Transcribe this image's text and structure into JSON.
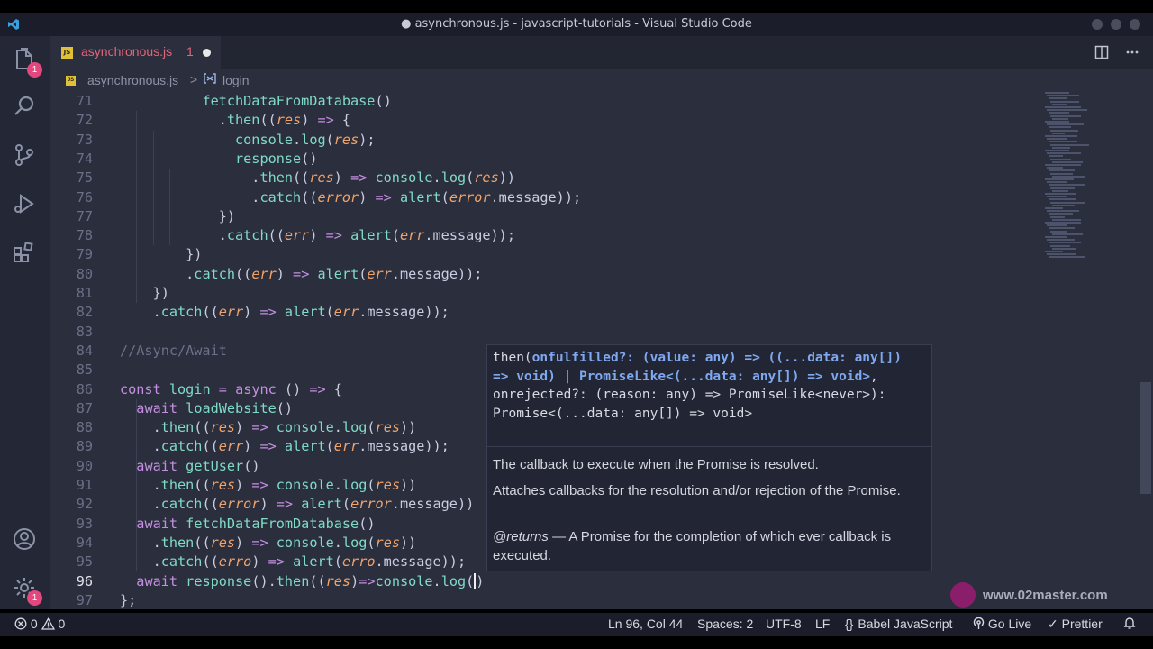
{
  "window": {
    "title": "● asynchronous.js - javascript-tutorials - Visual Studio Code"
  },
  "activity_bar": {
    "explorer_badge": "1",
    "settings_badge": "1"
  },
  "tab": {
    "file_icon": "JS",
    "name": "asynchronous.js",
    "problems": "1"
  },
  "breadcrumb": {
    "file": "asynchronous.js",
    "separator": ">",
    "symbol": "login"
  },
  "code_lines": [
    {
      "n": "71",
      "tokens": [
        [
          "pl",
          "          "
        ],
        [
          "fn",
          "fetchDataFromDatabase"
        ],
        [
          "pl",
          "()"
        ]
      ]
    },
    {
      "n": "72",
      "tokens": [
        [
          "pl",
          "            ."
        ],
        [
          "m",
          "then"
        ],
        [
          "pl",
          "(("
        ],
        [
          "par",
          "res"
        ],
        [
          "pl",
          ") "
        ],
        [
          "op",
          "=>"
        ],
        [
          "pl",
          " {"
        ]
      ]
    },
    {
      "n": "73",
      "tokens": [
        [
          "pl",
          "              "
        ],
        [
          "m",
          "console"
        ],
        [
          "pl",
          "."
        ],
        [
          "m",
          "log"
        ],
        [
          "pl",
          "("
        ],
        [
          "par",
          "res"
        ],
        [
          "pl",
          ");"
        ]
      ]
    },
    {
      "n": "74",
      "tokens": [
        [
          "pl",
          "              "
        ],
        [
          "fn",
          "response"
        ],
        [
          "pl",
          "()"
        ]
      ]
    },
    {
      "n": "75",
      "tokens": [
        [
          "pl",
          "                ."
        ],
        [
          "m",
          "then"
        ],
        [
          "pl",
          "(("
        ],
        [
          "par",
          "res"
        ],
        [
          "pl",
          ") "
        ],
        [
          "op",
          "=>"
        ],
        [
          "pl",
          " "
        ],
        [
          "m",
          "console"
        ],
        [
          "pl",
          "."
        ],
        [
          "m",
          "log"
        ],
        [
          "pl",
          "("
        ],
        [
          "par",
          "res"
        ],
        [
          "pl",
          "))"
        ]
      ]
    },
    {
      "n": "76",
      "tokens": [
        [
          "pl",
          "                ."
        ],
        [
          "m",
          "catch"
        ],
        [
          "pl",
          "(("
        ],
        [
          "par",
          "error"
        ],
        [
          "pl",
          ") "
        ],
        [
          "op",
          "=>"
        ],
        [
          "pl",
          " "
        ],
        [
          "m",
          "alert"
        ],
        [
          "pl",
          "("
        ],
        [
          "par",
          "error"
        ],
        [
          "pl",
          ".message));"
        ]
      ]
    },
    {
      "n": "77",
      "tokens": [
        [
          "pl",
          "            })"
        ]
      ]
    },
    {
      "n": "78",
      "tokens": [
        [
          "pl",
          "            ."
        ],
        [
          "m",
          "catch"
        ],
        [
          "pl",
          "(("
        ],
        [
          "par",
          "err"
        ],
        [
          "pl",
          ") "
        ],
        [
          "op",
          "=>"
        ],
        [
          "pl",
          " "
        ],
        [
          "m",
          "alert"
        ],
        [
          "pl",
          "("
        ],
        [
          "par",
          "err"
        ],
        [
          "pl",
          ".message));"
        ]
      ]
    },
    {
      "n": "79",
      "tokens": [
        [
          "pl",
          "        })"
        ]
      ]
    },
    {
      "n": "80",
      "tokens": [
        [
          "pl",
          "        ."
        ],
        [
          "m",
          "catch"
        ],
        [
          "pl",
          "(("
        ],
        [
          "par",
          "err"
        ],
        [
          "pl",
          ") "
        ],
        [
          "op",
          "=>"
        ],
        [
          "pl",
          " "
        ],
        [
          "m",
          "alert"
        ],
        [
          "pl",
          "("
        ],
        [
          "par",
          "err"
        ],
        [
          "pl",
          ".message));"
        ]
      ]
    },
    {
      "n": "81",
      "tokens": [
        [
          "pl",
          "    })"
        ]
      ]
    },
    {
      "n": "82",
      "tokens": [
        [
          "pl",
          "    ."
        ],
        [
          "m",
          "catch"
        ],
        [
          "pl",
          "(("
        ],
        [
          "par",
          "err"
        ],
        [
          "pl",
          ") "
        ],
        [
          "op",
          "=>"
        ],
        [
          "pl",
          " "
        ],
        [
          "m",
          "alert"
        ],
        [
          "pl",
          "("
        ],
        [
          "par",
          "err"
        ],
        [
          "pl",
          ".message));"
        ]
      ]
    },
    {
      "n": "83",
      "tokens": []
    },
    {
      "n": "84",
      "tokens": [
        [
          "cm",
          "//Async/Await"
        ]
      ]
    },
    {
      "n": "85",
      "tokens": []
    },
    {
      "n": "86",
      "tokens": [
        [
          "kw",
          "const"
        ],
        [
          "pl",
          " "
        ],
        [
          "fn",
          "login"
        ],
        [
          "pl",
          " "
        ],
        [
          "op",
          "="
        ],
        [
          "pl",
          " "
        ],
        [
          "kw",
          "async"
        ],
        [
          "pl",
          " () "
        ],
        [
          "op",
          "=>"
        ],
        [
          "pl",
          " {"
        ]
      ]
    },
    {
      "n": "87",
      "tokens": [
        [
          "pl",
          "  "
        ],
        [
          "kw",
          "await"
        ],
        [
          "pl",
          " "
        ],
        [
          "fn",
          "loadWebsite"
        ],
        [
          "pl",
          "()"
        ]
      ]
    },
    {
      "n": "88",
      "tokens": [
        [
          "pl",
          "    ."
        ],
        [
          "m",
          "then"
        ],
        [
          "pl",
          "(("
        ],
        [
          "par",
          "res"
        ],
        [
          "pl",
          ") "
        ],
        [
          "op",
          "=>"
        ],
        [
          "pl",
          " "
        ],
        [
          "m",
          "console"
        ],
        [
          "pl",
          "."
        ],
        [
          "m",
          "log"
        ],
        [
          "pl",
          "("
        ],
        [
          "par",
          "res"
        ],
        [
          "pl",
          "))"
        ]
      ]
    },
    {
      "n": "89",
      "tokens": [
        [
          "pl",
          "    ."
        ],
        [
          "m",
          "catch"
        ],
        [
          "pl",
          "(("
        ],
        [
          "par",
          "err"
        ],
        [
          "pl",
          ") "
        ],
        [
          "op",
          "=>"
        ],
        [
          "pl",
          " "
        ],
        [
          "m",
          "alert"
        ],
        [
          "pl",
          "("
        ],
        [
          "par",
          "err"
        ],
        [
          "pl",
          ".message));"
        ]
      ]
    },
    {
      "n": "90",
      "tokens": [
        [
          "pl",
          "  "
        ],
        [
          "kw",
          "await"
        ],
        [
          "pl",
          " "
        ],
        [
          "fn",
          "getUser"
        ],
        [
          "pl",
          "()"
        ]
      ]
    },
    {
      "n": "91",
      "tokens": [
        [
          "pl",
          "    ."
        ],
        [
          "m",
          "then"
        ],
        [
          "pl",
          "(("
        ],
        [
          "par",
          "res"
        ],
        [
          "pl",
          ") "
        ],
        [
          "op",
          "=>"
        ],
        [
          "pl",
          " "
        ],
        [
          "m",
          "console"
        ],
        [
          "pl",
          "."
        ],
        [
          "m",
          "log"
        ],
        [
          "pl",
          "("
        ],
        [
          "par",
          "res"
        ],
        [
          "pl",
          "))"
        ]
      ]
    },
    {
      "n": "92",
      "tokens": [
        [
          "pl",
          "    ."
        ],
        [
          "m",
          "catch"
        ],
        [
          "pl",
          "(("
        ],
        [
          "par",
          "error"
        ],
        [
          "pl",
          ") "
        ],
        [
          "op",
          "=>"
        ],
        [
          "pl",
          " "
        ],
        [
          "m",
          "alert"
        ],
        [
          "pl",
          "("
        ],
        [
          "par",
          "error"
        ],
        [
          "pl",
          ".message))"
        ]
      ]
    },
    {
      "n": "93",
      "tokens": [
        [
          "pl",
          "  "
        ],
        [
          "kw",
          "await"
        ],
        [
          "pl",
          " "
        ],
        [
          "fn",
          "fetchDataFromDatabase"
        ],
        [
          "pl",
          "()"
        ]
      ]
    },
    {
      "n": "94",
      "tokens": [
        [
          "pl",
          "    ."
        ],
        [
          "m",
          "then"
        ],
        [
          "pl",
          "(("
        ],
        [
          "par",
          "res"
        ],
        [
          "pl",
          ") "
        ],
        [
          "op",
          "=>"
        ],
        [
          "pl",
          " "
        ],
        [
          "m",
          "console"
        ],
        [
          "pl",
          "."
        ],
        [
          "m",
          "log"
        ],
        [
          "pl",
          "("
        ],
        [
          "par",
          "res"
        ],
        [
          "pl",
          "))"
        ]
      ]
    },
    {
      "n": "95",
      "tokens": [
        [
          "pl",
          "    ."
        ],
        [
          "m",
          "catch"
        ],
        [
          "pl",
          "(("
        ],
        [
          "par",
          "erro"
        ],
        [
          "pl",
          ") "
        ],
        [
          "op",
          "=>"
        ],
        [
          "pl",
          " "
        ],
        [
          "m",
          "alert"
        ],
        [
          "pl",
          "("
        ],
        [
          "par",
          "erro"
        ],
        [
          "pl",
          ".message));"
        ]
      ]
    },
    {
      "n": "96",
      "active": true,
      "tokens": [
        [
          "pl",
          "  "
        ],
        [
          "kw",
          "await"
        ],
        [
          "pl",
          " "
        ],
        [
          "fn",
          "response"
        ],
        [
          "pl",
          "()."
        ],
        [
          "m",
          "then"
        ],
        [
          "pl",
          "(("
        ],
        [
          "par",
          "res"
        ],
        [
          "pl",
          ")"
        ],
        [
          "op",
          "=>"
        ],
        [
          "m",
          "console"
        ],
        [
          "pl",
          "."
        ],
        [
          "m",
          "log"
        ],
        [
          "pl",
          "("
        ],
        [
          "caret",
          ""
        ],
        [
          "pl",
          ")"
        ]
      ]
    },
    {
      "n": "97",
      "tokens": [
        [
          "pl",
          "};"
        ]
      ]
    }
  ],
  "hover": {
    "signature": [
      [
        "t",
        "then("
      ],
      [
        "b",
        "onfulfilled?: (value: any) => ((...data: any[]) => void) | PromiseLike<(...data: any[]) => void>"
      ],
      [
        "t",
        ", onrejected?: (reason: any) => PromiseLike<never>): Promise<(...data: any[]) => void>"
      ]
    ],
    "doc_param": "The callback to execute when the Promise is resolved.",
    "doc_summary": "Attaches callbacks for the resolution and/or rejection of the Promise.",
    "returns_tag": "@returns",
    "returns_text": " — A Promise for the completion of which ever callback is executed."
  },
  "watermark": "www.02master.com",
  "status_bar": {
    "errors": "0",
    "warnings": "0",
    "position": "Ln 96, Col 44",
    "spaces": "Spaces: 2",
    "encoding": "UTF-8",
    "eol": "LF",
    "language": "Babel JavaScript",
    "go_live": "Go Live",
    "prettier": "Prettier"
  },
  "colors": {
    "editor_bg": "#2b2e3d",
    "function": "#7fdbc6",
    "keyword": "#c48fe0",
    "parameter": "#f0a36b",
    "tab_modified": "#e2657a",
    "badge": "#e2477d"
  }
}
